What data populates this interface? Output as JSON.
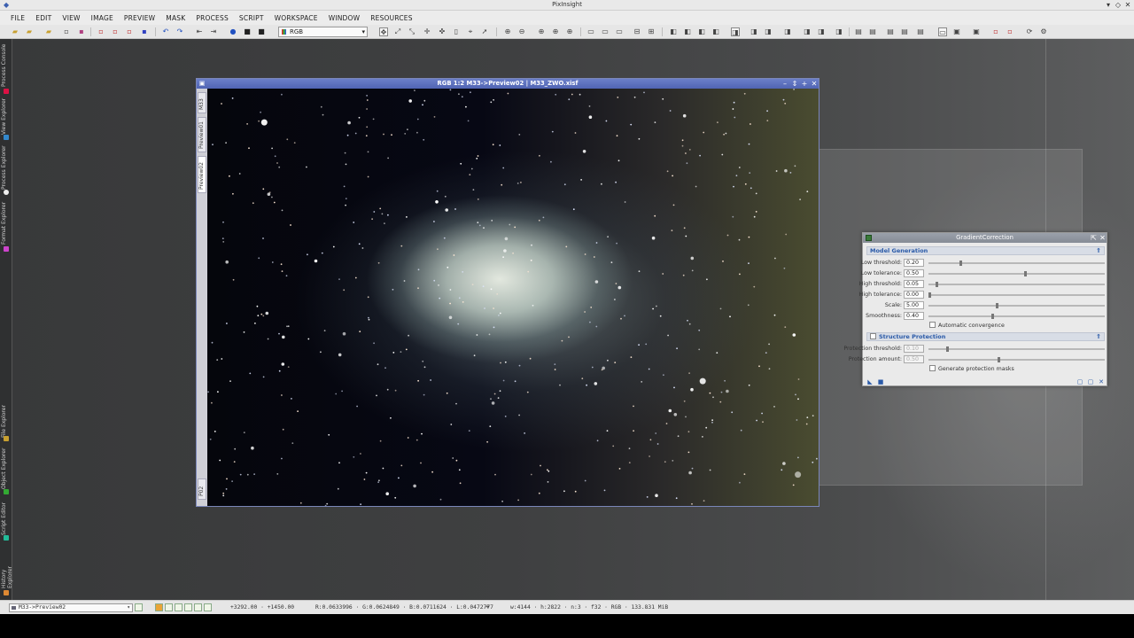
{
  "app": {
    "title": "PixInsight"
  },
  "menu": [
    "FILE",
    "EDIT",
    "VIEW",
    "IMAGE",
    "PREVIEW",
    "MASK",
    "PROCESS",
    "SCRIPT",
    "WORKSPACE",
    "WINDOW",
    "RESOURCES"
  ],
  "toolbar": {
    "channel": "RGB"
  },
  "dock_tabs": {
    "top": [
      "Process Console",
      "View Explorer",
      "Process Explorer",
      "Format Explorer"
    ],
    "bottom": [
      "File Explorer",
      "Object Explorer",
      "Script Editor",
      "History Explorer"
    ]
  },
  "image_window": {
    "title": "RGB 1:2 M33->Preview02 | M33_ZWO.xisf",
    "tabs": [
      "M33",
      "Preview01",
      "Preview02",
      "P02"
    ]
  },
  "gradient_correction": {
    "title": "GradientCorrection",
    "model_generation": {
      "header": "Model Generation",
      "params": [
        {
          "label": "Low threshold:",
          "value": "0.20",
          "level": 0.18
        },
        {
          "label": "Low tolerance:",
          "value": "0.50",
          "level": 0.55
        },
        {
          "label": "High threshold:",
          "value": "0.05",
          "level": 0.04
        },
        {
          "label": "High tolerance:",
          "value": "0.00",
          "level": 0.0
        },
        {
          "label": "Scale:",
          "value": "5.00",
          "level": 0.39
        },
        {
          "label": "Smoothness:",
          "value": "0.40",
          "level": 0.36
        }
      ],
      "auto_convergence": "Automatic convergence"
    },
    "structure_protection": {
      "header": "Structure Protection",
      "params": [
        {
          "label": "Protection threshold:",
          "value": "0.10",
          "level": 0.1
        },
        {
          "label": "Protection amount:",
          "value": "0.50",
          "level": 0.4
        }
      ],
      "masks": "Generate protection masks"
    }
  },
  "status": {
    "view": "M33->Preview02",
    "coords": "+3292.00 · +1450.00",
    "values": "R:0.0633996 · G:0.0624849 · B:0.0711624 · L:0.0472777",
    "info": "w:4144 · h:2822 · n:3 · f32 · RGB · 133.831 MiB"
  }
}
